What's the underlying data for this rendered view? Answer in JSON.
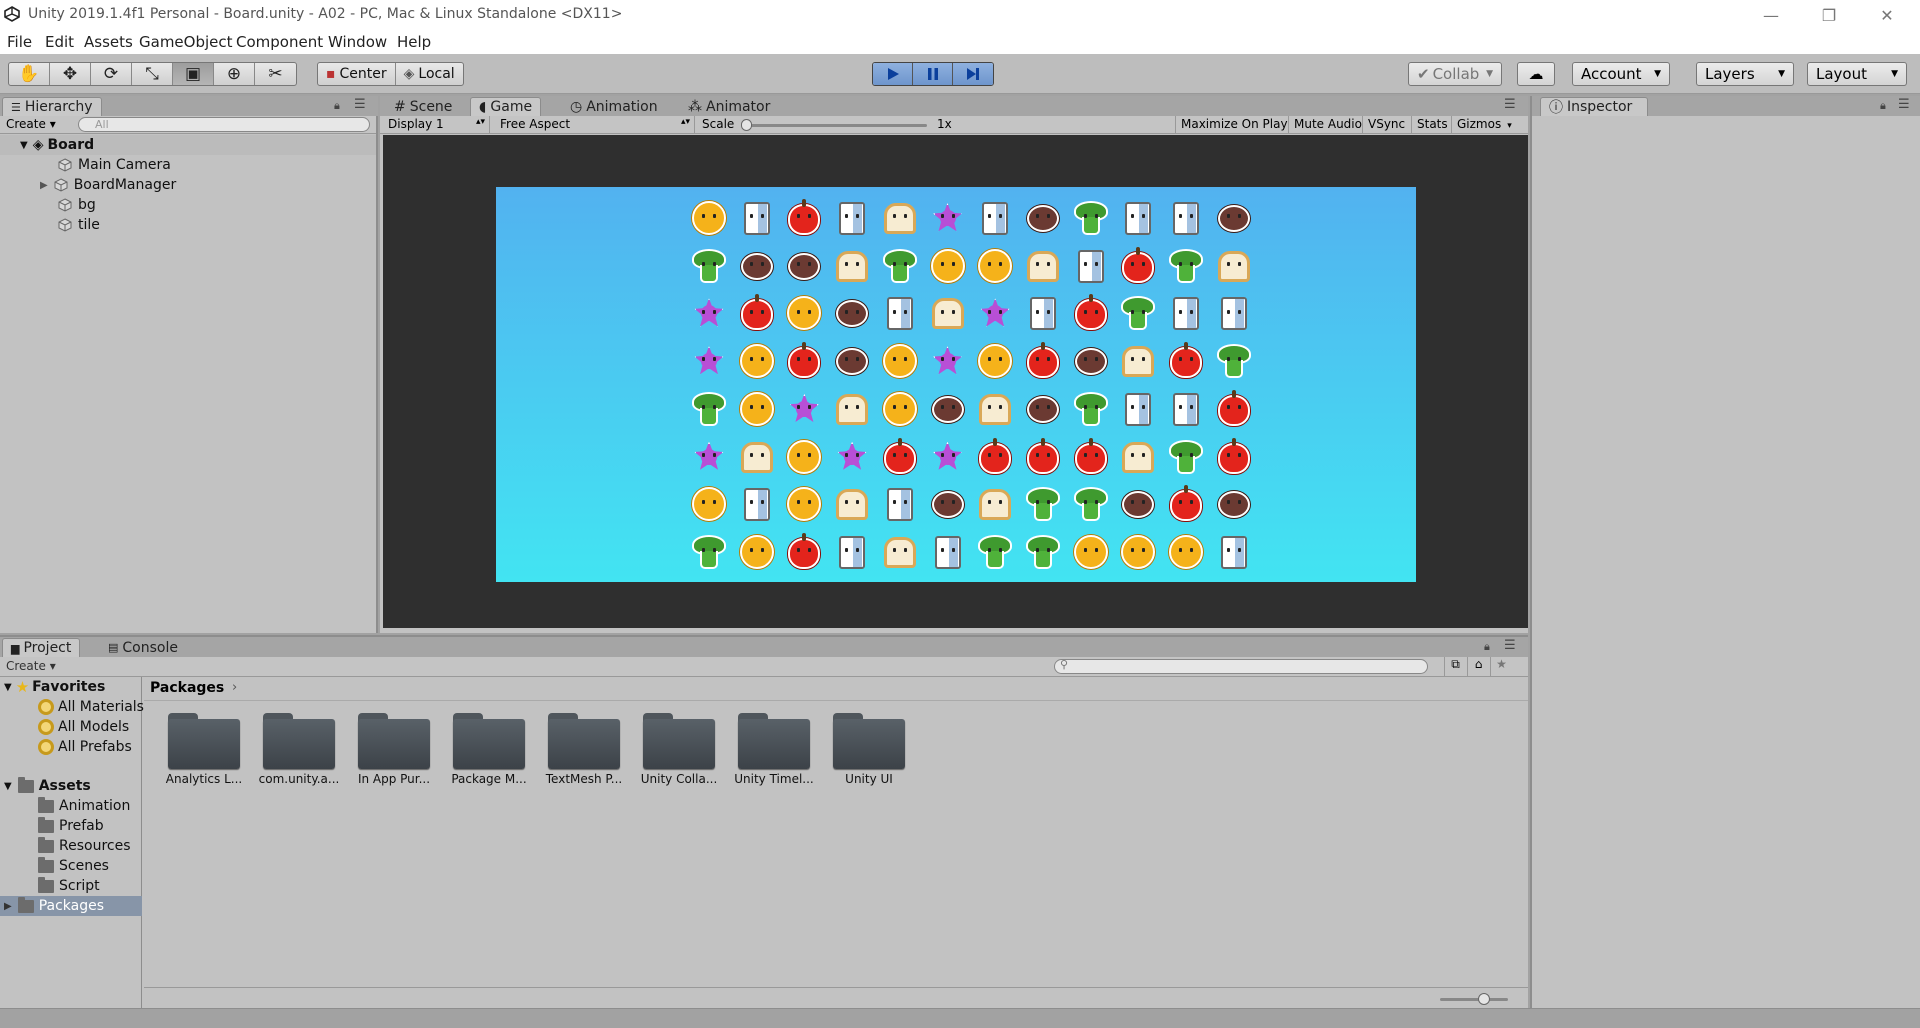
{
  "window": {
    "title": "Unity 2019.1.4f1 Personal - Board.unity - A02 - PC, Mac & Linux Standalone <DX11>",
    "minimize": "—",
    "restore": "❐",
    "close": "✕"
  },
  "menu": [
    "File",
    "Edit",
    "Assets",
    "GameObject",
    "Component",
    "Window",
    "Help"
  ],
  "toolbar": {
    "pivot_center": "Center",
    "pivot_local": "Local",
    "collab": "Collab",
    "account": "Account",
    "layers": "Layers",
    "layout": "Layout"
  },
  "hierarchy": {
    "tab": "Hierarchy",
    "create": "Create",
    "search_placeholder": "All",
    "scene": "Board",
    "items": [
      "Main Camera",
      "BoardManager",
      "bg",
      "tile"
    ]
  },
  "center_tabs": [
    "Scene",
    "Game",
    "Animation",
    "Animator"
  ],
  "game_bar": {
    "display": "Display 1",
    "aspect": "Free Aspect",
    "scale_label": "Scale",
    "scale_value": "1x",
    "maximize": "Maximize On Play",
    "mute": "Mute Audio",
    "vsync": "VSync",
    "stats": "Stats",
    "gizmos": "Gizmos"
  },
  "game_grid": [
    [
      "orange",
      "milk",
      "apple",
      "milk",
      "bread",
      "flower",
      "milk",
      "coconut",
      "broccoli",
      "milk",
      "milk",
      "coconut"
    ],
    [
      "broccoli",
      "coconut",
      "coconut",
      "bread",
      "broccoli",
      "orange",
      "orange",
      "bread",
      "milk",
      "apple",
      "broccoli",
      "bread"
    ],
    [
      "flower",
      "apple",
      "orange",
      "coconut",
      "milk",
      "bread",
      "flower",
      "milk",
      "apple",
      "broccoli",
      "milk",
      "milk"
    ],
    [
      "flower",
      "orange",
      "apple",
      "coconut",
      "orange",
      "flower",
      "orange",
      "apple",
      "coconut",
      "bread",
      "apple",
      "broccoli"
    ],
    [
      "broccoli",
      "orange",
      "flower",
      "bread",
      "orange",
      "coconut",
      "bread",
      "coconut",
      "broccoli",
      "milk",
      "milk",
      "apple"
    ],
    [
      "flower",
      "bread",
      "orange",
      "flower",
      "apple",
      "flower",
      "apple",
      "apple",
      "apple",
      "bread",
      "broccoli",
      "apple"
    ],
    [
      "orange",
      "milk",
      "orange",
      "bread",
      "milk",
      "coconut",
      "bread",
      "broccoli",
      "broccoli",
      "coconut",
      "apple",
      "coconut"
    ],
    [
      "broccoli",
      "orange",
      "apple",
      "milk",
      "bread",
      "milk",
      "broccoli",
      "broccoli",
      "orange",
      "orange",
      "orange",
      "milk"
    ]
  ],
  "piece_colors": {
    "orange": "#f5b21a",
    "apple": "#e3241c",
    "milk": "#ffffff",
    "bread": "#f7ecd2",
    "flower": "#b84fd6",
    "coconut": "#6b3a32",
    "broccoli": "#3f9a2f"
  },
  "inspector": {
    "tab": "Inspector"
  },
  "bottom_tabs": {
    "project": "Project",
    "console": "Console"
  },
  "project": {
    "create": "Create",
    "favorites_label": "Favorites",
    "favorites": [
      "All Materials",
      "All Models",
      "All Prefabs"
    ],
    "assets_label": "Assets",
    "assets": [
      "Animation",
      "Prefab",
      "Resources",
      "Scenes",
      "Script"
    ],
    "packages_label": "Packages",
    "breadcrumb": "Packages",
    "folders": [
      "Analytics L...",
      "com.unity.a...",
      "In App Pur...",
      "Package M...",
      "TextMesh P...",
      "Unity Colla...",
      "Unity Timel...",
      "Unity UI"
    ]
  }
}
